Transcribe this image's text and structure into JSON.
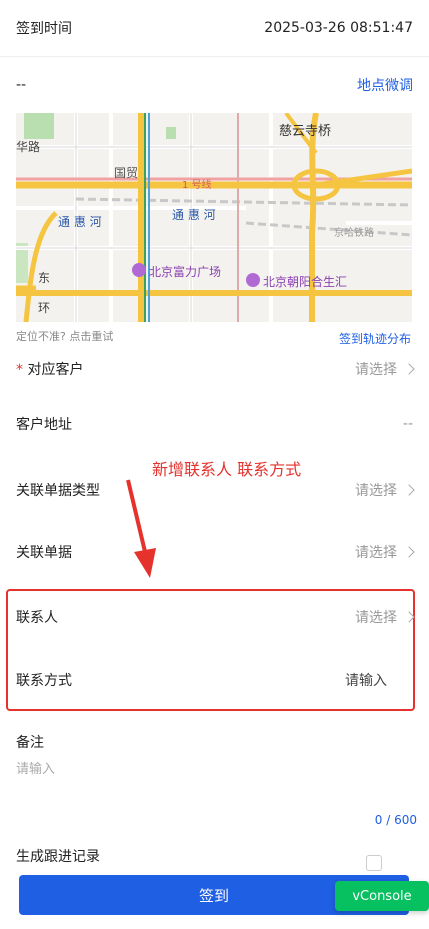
{
  "checkin_time": {
    "label": "签到时间",
    "value": "2025-03-26 08:51:47"
  },
  "location": {
    "value": "--",
    "adjust_link": "地点微调"
  },
  "map": {
    "labels": {
      "ciyunsi": "慈云寺桥",
      "guomao": "国贸",
      "line1": "1 号线",
      "tonghui1": "通 惠 河",
      "tonghui2": "通 惠 河",
      "jinghalu": "京哈铁路",
      "fuli": "北京富力广场",
      "heshenghui": "北京朝阳合生汇",
      "dong": "东",
      "huan": "环",
      "hualu": "华路"
    },
    "hint": "定位不准? 点击重试",
    "track_link": "签到轨迹分布"
  },
  "form": {
    "customer": {
      "required_mark": "*",
      "label": "对应客户",
      "placeholder": "请选择"
    },
    "address": {
      "label": "客户地址",
      "value": "--"
    },
    "doc_type": {
      "label": "关联单据类型",
      "placeholder": "请选择"
    },
    "doc": {
      "label": "关联单据",
      "placeholder": "请选择"
    },
    "contact": {
      "label": "联系人",
      "placeholder": "请选择"
    },
    "contact_method": {
      "label": "联系方式",
      "placeholder": "请输入"
    },
    "remark": {
      "label": "备注",
      "placeholder": "请输入",
      "counter": "0 / 600"
    },
    "follow_up": {
      "label": "生成跟进记录"
    }
  },
  "annotation": {
    "text": "新增联系人 联系方式"
  },
  "submit_label": "签到",
  "vconsole_label": "vConsole",
  "colors": {
    "primary": "#1f5fe3",
    "annotation": "#e5322d",
    "vconsole": "#07c160"
  }
}
